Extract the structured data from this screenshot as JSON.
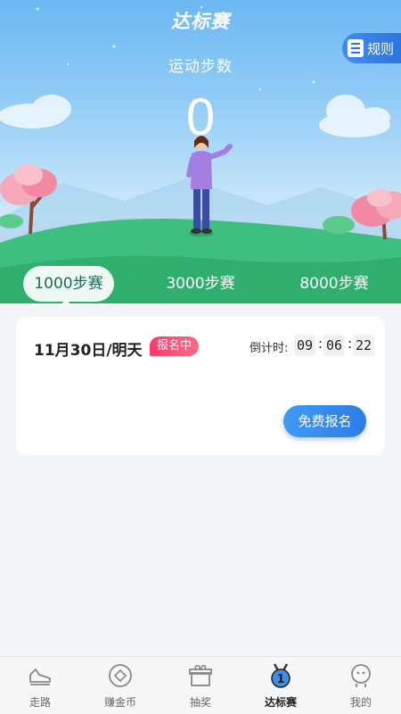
{
  "header": {
    "title": "达标赛",
    "rules_label": "规则",
    "steps_label": "运动步数",
    "steps_value": "0"
  },
  "tabs": [
    {
      "label": "1000步赛",
      "active": true
    },
    {
      "label": "3000步赛",
      "active": false
    },
    {
      "label": "8000步赛",
      "active": false
    }
  ],
  "card": {
    "date": "11月30日/明天",
    "status_badge": "报名中",
    "countdown_label": "倒计时:",
    "countdown": {
      "hours": "09",
      "minutes": "06",
      "seconds": "22"
    },
    "signup_label": "免费报名"
  },
  "nav": [
    {
      "label": "走路",
      "icon": "shoe-icon",
      "active": false
    },
    {
      "label": "赚金币",
      "icon": "coin-icon",
      "active": false
    },
    {
      "label": "抽奖",
      "icon": "gift-box-icon",
      "active": false
    },
    {
      "label": "达标赛",
      "icon": "medal-icon",
      "active": true,
      "badge_number": "1"
    },
    {
      "label": "我的",
      "icon": "profile-icon",
      "active": false
    }
  ],
  "colors": {
    "accent_blue": "#2f7be6",
    "badge_red": "#ff3a6a",
    "active_tab_text": "#1f6a57"
  }
}
